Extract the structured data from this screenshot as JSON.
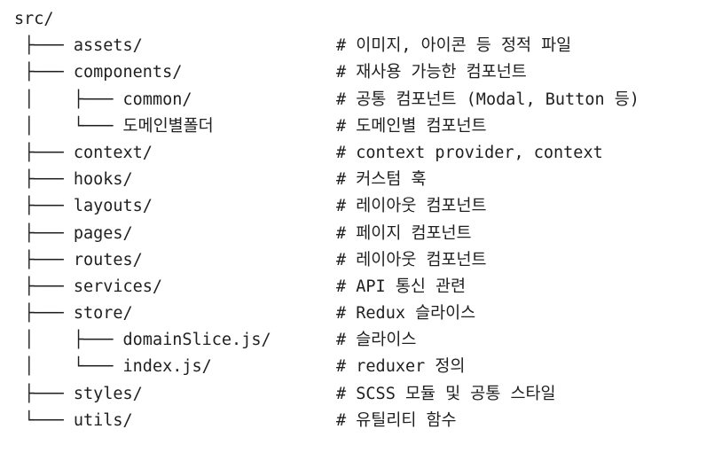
{
  "tree": {
    "rows": [
      {
        "prefix": "src/",
        "name": "",
        "comment": ""
      },
      {
        "prefix": " ├─── ",
        "name": "assets/",
        "comment": "# 이미지, 아이콘 등 정적 파일"
      },
      {
        "prefix": " ├─── ",
        "name": "components/",
        "comment": "# 재사용 가능한 컴포넌트"
      },
      {
        "prefix": " │    ├─── ",
        "name": "common/",
        "comment": "# 공통 컴포넌트 (Modal, Button 등)"
      },
      {
        "prefix": " │    └─── ",
        "name": "도메인별폴더",
        "comment": "# 도메인별 컴포넌트"
      },
      {
        "prefix": " ├─── ",
        "name": "context/",
        "comment": "# context provider, context"
      },
      {
        "prefix": " ├─── ",
        "name": "hooks/",
        "comment": "# 커스텀 훅"
      },
      {
        "prefix": " ├─── ",
        "name": "layouts/",
        "comment": "# 레이아웃 컴포넌트"
      },
      {
        "prefix": " ├─── ",
        "name": "pages/",
        "comment": "# 페이지 컴포넌트"
      },
      {
        "prefix": " ├─── ",
        "name": "routes/",
        "comment": "# 레이아웃 컴포넌트"
      },
      {
        "prefix": " ├─── ",
        "name": "services/",
        "comment": "# API 통신 관련"
      },
      {
        "prefix": " ├─── ",
        "name": "store/",
        "comment": "# Redux 슬라이스"
      },
      {
        "prefix": " │    ├─── ",
        "name": "domainSlice.js/",
        "comment": "# 슬라이스"
      },
      {
        "prefix": " │    └─── ",
        "name": "index.js/",
        "comment": "# reduxer 정의"
      },
      {
        "prefix": " ├─── ",
        "name": "styles/",
        "comment": "# SCSS 모듈 및 공통 스타일"
      },
      {
        "prefix": " └─── ",
        "name": "utils/",
        "comment": "# 유틸리티 함수"
      }
    ]
  }
}
